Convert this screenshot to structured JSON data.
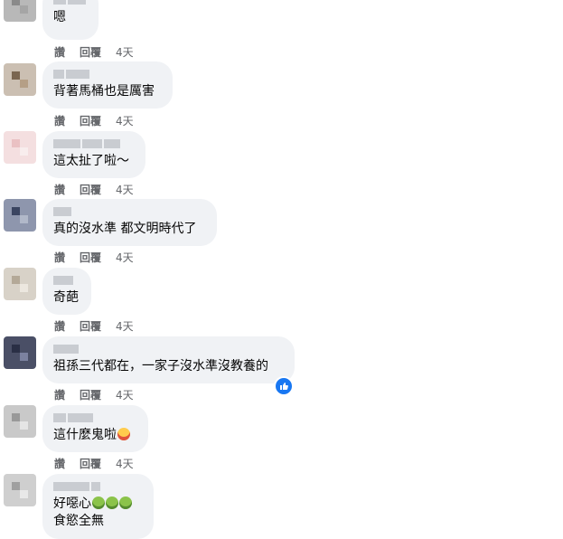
{
  "actions": {
    "like": "讚",
    "reply": "回覆"
  },
  "comments": [
    {
      "text": "嗯",
      "time": "4天"
    },
    {
      "text": "背著馬桶也是厲害",
      "time": "4天"
    },
    {
      "text": "這太扯了啦～",
      "time": "4天"
    },
    {
      "text": "真的沒水準 都文明時代了",
      "time": "4天"
    },
    {
      "text": "奇葩",
      "time": "4天"
    },
    {
      "text": "祖孫三代都在，一家子沒水準沒教養的",
      "time": "4天",
      "reaction": "like"
    },
    {
      "text": "這什麼鬼啦",
      "time": "4天",
      "emoji": [
        "rolling-on-floor-laughing"
      ]
    },
    {
      "text": "好噁心",
      "text2": "食慾全無",
      "time": "4天",
      "emoji": [
        "nauseated-face",
        "nauseated-face",
        "nauseated-face"
      ]
    }
  ],
  "colors": {
    "bubble": "#f0f2f5",
    "meta": "#65676b",
    "reaction": "#1877f2"
  }
}
